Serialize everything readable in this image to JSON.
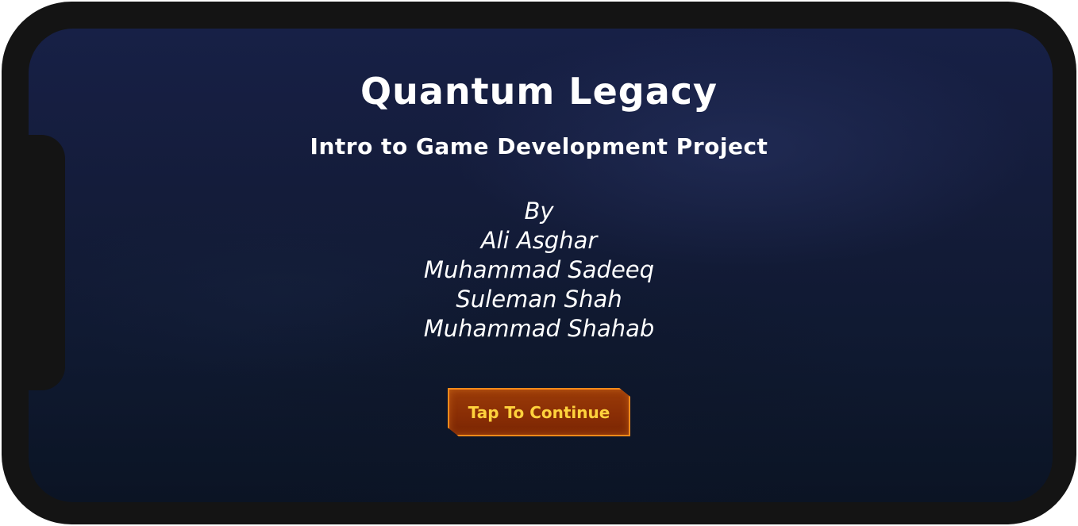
{
  "game": {
    "title": "Quantum Legacy",
    "subtitle": "Intro to Game Development Project"
  },
  "credits": {
    "by_label": "By",
    "authors": [
      "Ali Asghar",
      "Muhammad Sadeeq",
      "Suleman Shah",
      "Muhammad Shahab"
    ]
  },
  "continue_button": {
    "label": "Tap To Continue"
  },
  "colors": {
    "background": "#141c3a",
    "button_fill": "#8a2e05",
    "button_border": "#ff8a1a",
    "button_text": "#ffd23c",
    "text": "#ffffff"
  }
}
